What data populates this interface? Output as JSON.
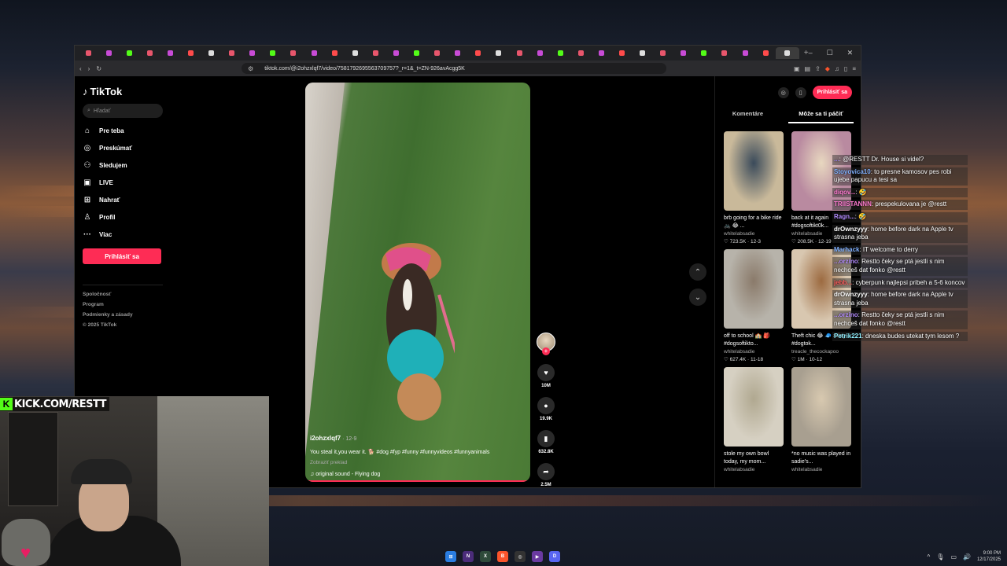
{
  "browser": {
    "tab_count": 35,
    "url": "tiktok.com/@i2ohzxlqf7/video/7581792695563709757?_r=1&_t=ZN-926avAcgg5K"
  },
  "sidenav": {
    "logo": "TikTok",
    "search_placeholder": "Hľadať",
    "items": [
      {
        "label": "Pre teba",
        "icon": "home-icon"
      },
      {
        "label": "Preskúmať",
        "icon": "compass-icon"
      },
      {
        "label": "Sledujem",
        "icon": "following-icon"
      },
      {
        "label": "LIVE",
        "icon": "live-icon"
      },
      {
        "label": "Nahrať",
        "icon": "upload-icon"
      },
      {
        "label": "Profil",
        "icon": "profile-icon"
      },
      {
        "label": "Viac",
        "icon": "more-icon"
      }
    ],
    "login": "Prihlásiť sa",
    "footer": [
      "Spoločnosť",
      "Program",
      "Podmienky a zásady",
      "© 2025 TikTok"
    ]
  },
  "video": {
    "author": "i2ohzxlqf7",
    "date": "· 12-9",
    "caption": "You steal it,you wear it. 🐕 #dog #fyp #funny #funnyvideos #funnyanimals",
    "translate": "Zobraziť preklad",
    "sound": "♫  original sound - Flying dog",
    "likes": "10M",
    "comments": "19.9K",
    "saves": "632.8K",
    "shares": "2.5M"
  },
  "rightpanel": {
    "login": "Prihlásiť sa",
    "tabs": [
      "Komentáre",
      "Môže sa ti páčiť"
    ],
    "cards": [
      {
        "title": "brb going for a bike ride 🚲 😂 ...",
        "user": "whitelabsadie",
        "stats": "♡ 723.5K · 12-3",
        "c1": "#c9b99a",
        "c2": "#3a4a5a"
      },
      {
        "title": "back at it again #dogsoftikt0k...",
        "user": "whitelabsadie",
        "stats": "♡ 208.5K · 12-19",
        "c1": "#b98aa0",
        "c2": "#e8d8c0"
      },
      {
        "title": "off to school 🏫 🎒 #dogsoftikto...",
        "user": "whitelabsadie",
        "stats": "♡ 627.4K · 11-18",
        "c1": "#b7b3aa",
        "c2": "#8a7a6a"
      },
      {
        "title": "Theft chic 😂 🧢 #dog #dogtok...",
        "user": "treacle_thecockapoo",
        "stats": "♡ 1M · 10-12",
        "c1": "#d8c7b0",
        "c2": "#9c6a40"
      },
      {
        "title": "stole my own bowl today, my mom...",
        "user": "whitelabsadie",
        "stats": "",
        "c1": "#d6d0c2",
        "c2": "#b0a890"
      },
      {
        "title": "*no music was played in sadie's...",
        "user": "whitelabsadie",
        "stats": "",
        "c1": "#a89f90",
        "c2": "#d8c9b0"
      }
    ]
  },
  "chat": [
    {
      "user": "...",
      "color": "#9b7cff",
      "text": "@RESTT Dr. House si videl?"
    },
    {
      "user": "Stoyovica10",
      "color": "#7fb0ff",
      "text": "to presne kamosov pes robi ujebe papucu a tesi sa"
    },
    {
      "user": "diqov...",
      "color": "#ff7ad1",
      "text": "🤣"
    },
    {
      "user": "TRIISTANNN",
      "color": "#ff7ad1",
      "text": "prespekulovana je @restt"
    },
    {
      "user": "Ragn...",
      "color": "#b38bff",
      "text": "🤣"
    },
    {
      "user": "drOwnzyyy",
      "color": "#ffffff",
      "text": "home before dark na Apple tv strasna jeba"
    },
    {
      "user": "Marhack",
      "color": "#7fb0ff",
      "text": "IT welcome to derry"
    },
    {
      "user": "...orzino",
      "color": "#b38bff",
      "text": "Restto čeky se ptá jestli s nim nechceš dat fonko @restt"
    },
    {
      "user": "jebb...",
      "color": "#ff5a5a",
      "text": "cyberpunk najlepsi pribeh a 5-6 koncov"
    },
    {
      "user": "drOwnzyyy",
      "color": "#ffffff",
      "text": "home before dark na Apple tv strasna jeba"
    },
    {
      "user": "...orzino",
      "color": "#b38bff",
      "text": "Restto čeky se ptá jestli s nim nechceš dat fonko @restt"
    },
    {
      "user": "Petrik221",
      "color": "#8ff0ff",
      "text": "dneska budes utekat tym lesom ?"
    }
  ],
  "stream": {
    "kick": "KICK.COM/RESTT"
  },
  "taskbar": {
    "time": "9:00 PM",
    "date": "12/17/2025"
  }
}
